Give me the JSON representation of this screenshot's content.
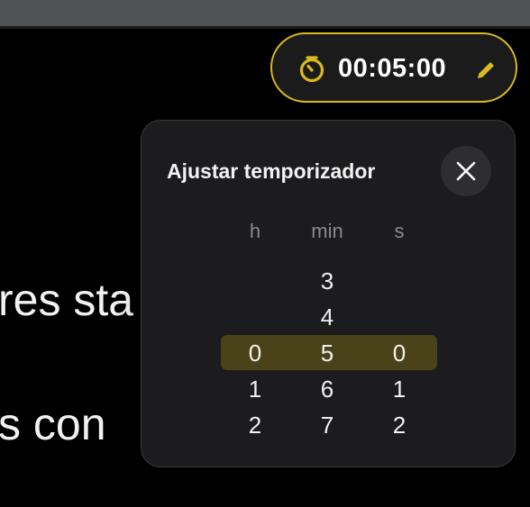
{
  "background": {
    "line1": "res sta",
    "line2": "s con"
  },
  "timer": {
    "value": "00:05:00",
    "icon": "timer-icon",
    "edit_icon": "pencil-icon",
    "accent_color": "#d9b91e"
  },
  "panel": {
    "title": "Ajustar temporizador",
    "close_icon": "close-icon",
    "columns": {
      "hours_label": "h",
      "minutes_label": "min",
      "seconds_label": "s"
    },
    "hours": {
      "selected": "0",
      "items": [
        "0",
        "1",
        "2"
      ]
    },
    "minutes": {
      "selected": "5",
      "items": [
        "3",
        "4",
        "5",
        "6",
        "7"
      ]
    },
    "seconds": {
      "selected": "0",
      "items": [
        "0",
        "1",
        "2"
      ]
    },
    "highlight_color": "#4a4219"
  }
}
